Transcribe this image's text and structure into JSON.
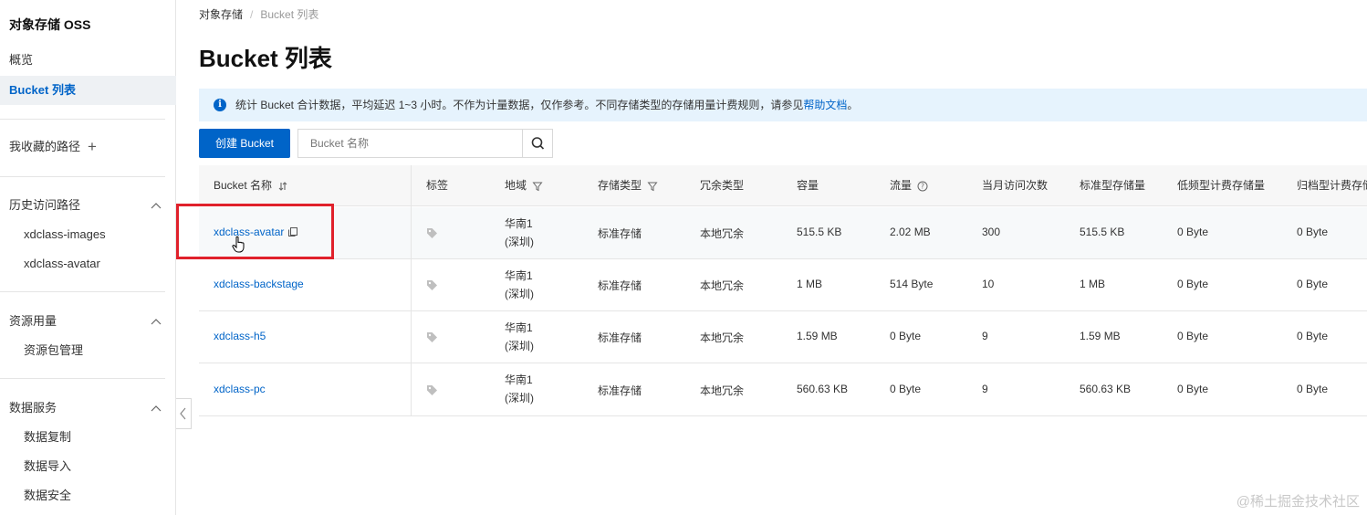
{
  "sidebar": {
    "title": "对象存储 OSS",
    "overview": "概览",
    "bucket_list": "Bucket 列表",
    "favorites": "我收藏的路径",
    "favorites_plus": "+",
    "history": {
      "label": "历史访问路径",
      "items": [
        "xdclass-images",
        "xdclass-avatar"
      ]
    },
    "resource": {
      "label": "资源用量",
      "items": [
        "资源包管理"
      ]
    },
    "data_service": {
      "label": "数据服务",
      "items": [
        "数据复制",
        "数据导入",
        "数据安全"
      ]
    }
  },
  "breadcrumb": {
    "root": "对象存储",
    "separator": "/",
    "current": "Bucket 列表"
  },
  "page_title": "Bucket 列表",
  "notice": {
    "text": "统计 Bucket 合计数据，平均延迟 1~3 小时。不作为计量数据，仅作参考。不同存储类型的存储用量计费规则，请参见",
    "link": "帮助文档",
    "end": "。"
  },
  "toolbar": {
    "create_label": "创建 Bucket",
    "search_placeholder": "Bucket 名称"
  },
  "table": {
    "headers": {
      "name": "Bucket 名称",
      "tags": "标签",
      "region": "地域",
      "storage_class": "存储类型",
      "redundancy": "冗余类型",
      "capacity": "容量",
      "traffic": "流量",
      "monthly_requests": "当月访问次数",
      "standard_storage": "标准型存储量",
      "ia_storage": "低频型计费存储量",
      "archive_storage": "归档型计费存储"
    },
    "rows": [
      {
        "name": "xdclass-avatar",
        "region_l1": "华南1",
        "region_l2": "(深圳)",
        "storage_class": "标准存储",
        "redundancy": "本地冗余",
        "capacity": "515.5 KB",
        "traffic": "2.02 MB",
        "monthly_requests": "300",
        "standard_storage": "515.5 KB",
        "ia_storage": "0 Byte",
        "archive_storage": "0 Byte"
      },
      {
        "name": "xdclass-backstage",
        "region_l1": "华南1",
        "region_l2": "(深圳)",
        "storage_class": "标准存储",
        "redundancy": "本地冗余",
        "capacity": "1 MB",
        "traffic": "514 Byte",
        "monthly_requests": "10",
        "standard_storage": "1 MB",
        "ia_storage": "0 Byte",
        "archive_storage": "0 Byte"
      },
      {
        "name": "xdclass-h5",
        "region_l1": "华南1",
        "region_l2": "(深圳)",
        "storage_class": "标准存储",
        "redundancy": "本地冗余",
        "capacity": "1.59 MB",
        "traffic": "0 Byte",
        "monthly_requests": "9",
        "standard_storage": "1.59 MB",
        "ia_storage": "0 Byte",
        "archive_storage": "0 Byte"
      },
      {
        "name": "xdclass-pc",
        "region_l1": "华南1",
        "region_l2": "(深圳)",
        "storage_class": "标准存储",
        "redundancy": "本地冗余",
        "capacity": "560.63 KB",
        "traffic": "0 Byte",
        "monthly_requests": "9",
        "standard_storage": "560.63 KB",
        "ia_storage": "0 Byte",
        "archive_storage": "0 Byte"
      }
    ]
  },
  "watermark": "@稀土掘金技术社区",
  "colors": {
    "accent": "#0064c8",
    "notice_bg": "#e6f3fd",
    "highlight_box": "#e0212b",
    "active_nav_bg": "#eef1f4"
  }
}
